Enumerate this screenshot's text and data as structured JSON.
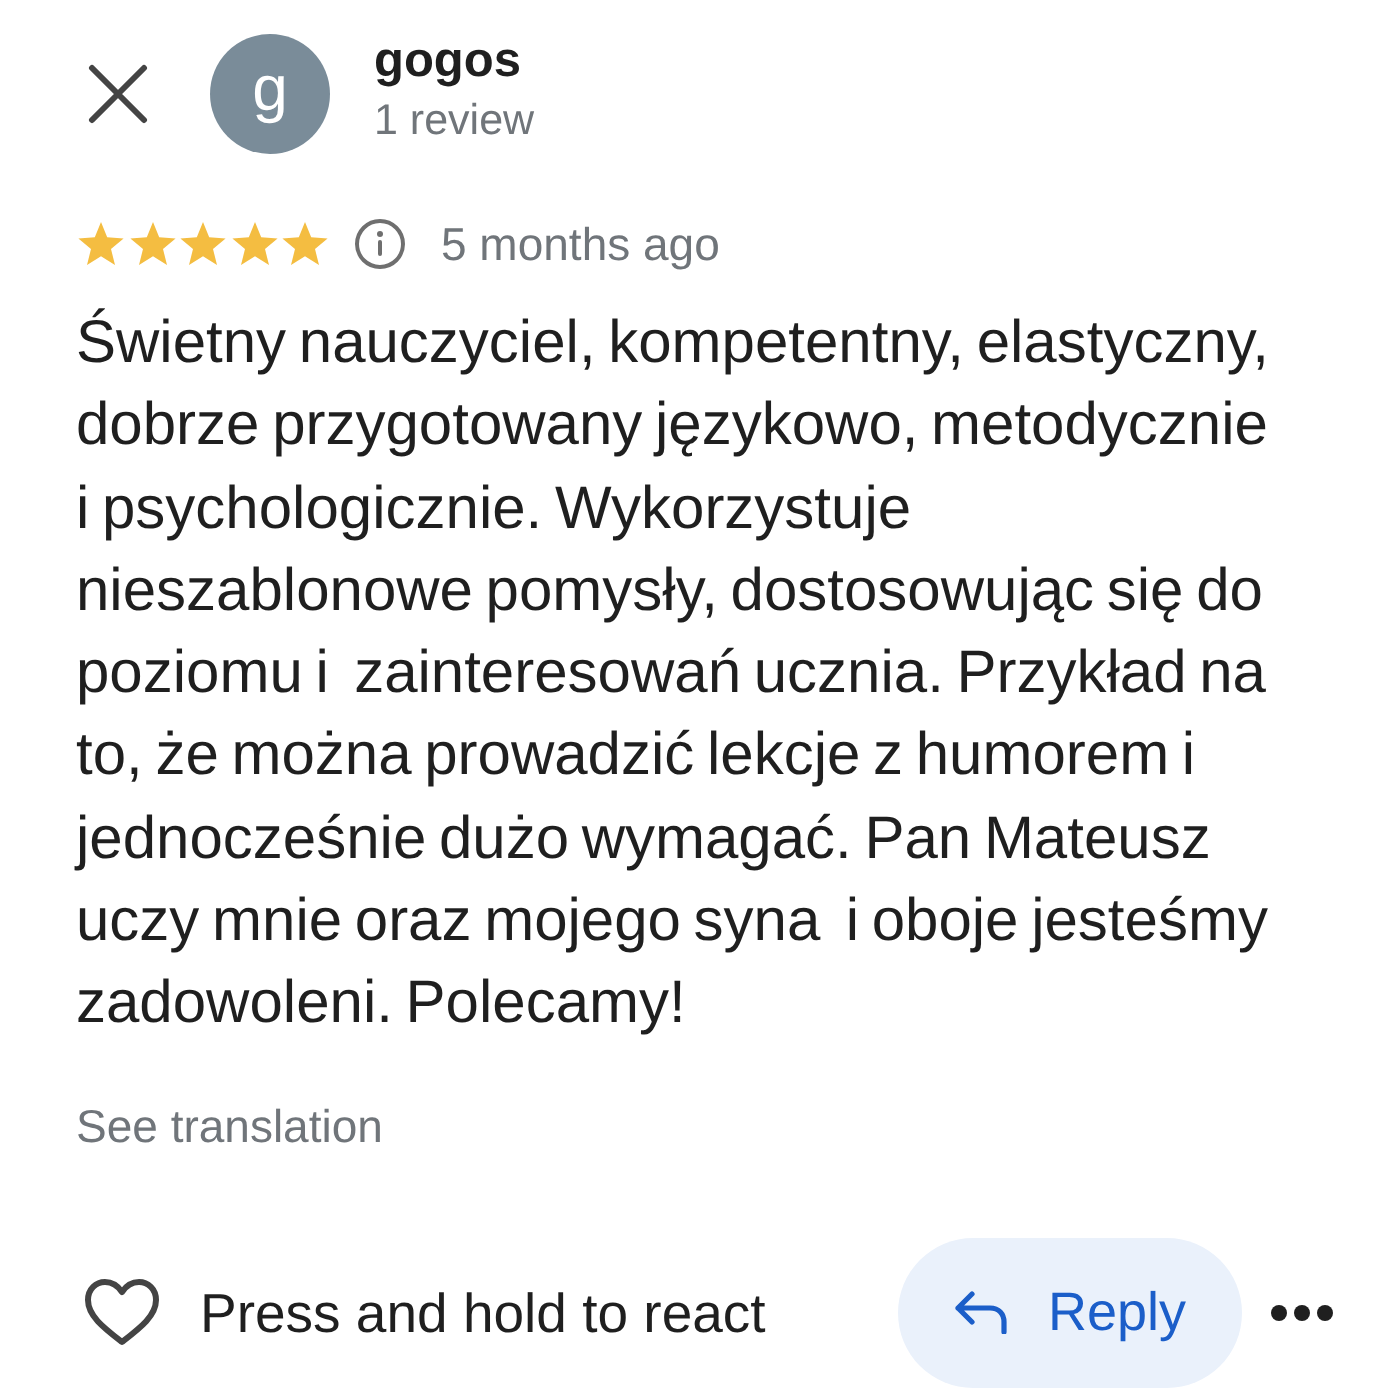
{
  "header": {
    "avatar_letter": "g",
    "author": "gogos",
    "review_count": "1 review"
  },
  "rating": {
    "stars": 5,
    "time": "5 months ago"
  },
  "body": "Świetny nauczyciel, kompetentny, elastyczny, dobrze przygotowany językowo, metodycznie i psychologicznie. Wykorzystuje nieszablonowe pomysły, dostosowując się do poziomu i  zainteresowań ucznia. Przykład na to, że można prowadzić lekcje z humorem i jednocześnie dużo wymagać. Pan Mateusz uczy mnie oraz mojego syna  i oboje jesteśmy zadowoleni. Polecamy!",
  "translate_link": "See translation",
  "actions": {
    "react_hint": "Press and hold to react",
    "reply": "Reply"
  }
}
